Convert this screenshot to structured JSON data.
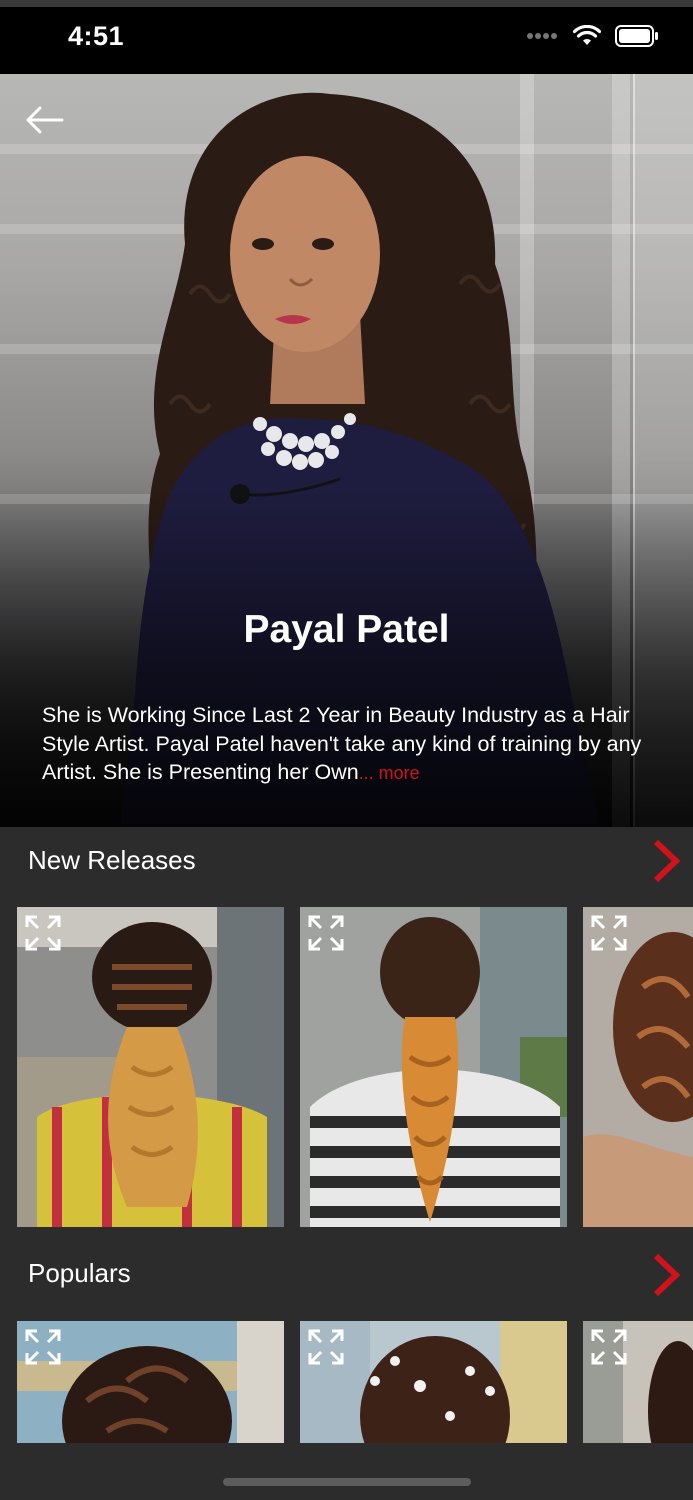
{
  "status_bar": {
    "time": "4:51"
  },
  "hero": {
    "artist_name": "Payal Patel",
    "bio": "She is Working Since Last 2 Year in Beauty Industry as a Hair Style Artist. Payal Patel haven't take any kind of training by any Artist. She is Presenting her Own",
    "more_label": "... more"
  },
  "sections": {
    "new_releases": {
      "title": "New Releases"
    },
    "populars": {
      "title": "Populars"
    }
  },
  "icons": {
    "back": "back-arrow-icon",
    "expand": "expand-icon",
    "chevron": "chevron-right-icon"
  },
  "colors": {
    "accent": "#d0121b",
    "background": "#2c2c2c",
    "status_bar": "#000000"
  }
}
